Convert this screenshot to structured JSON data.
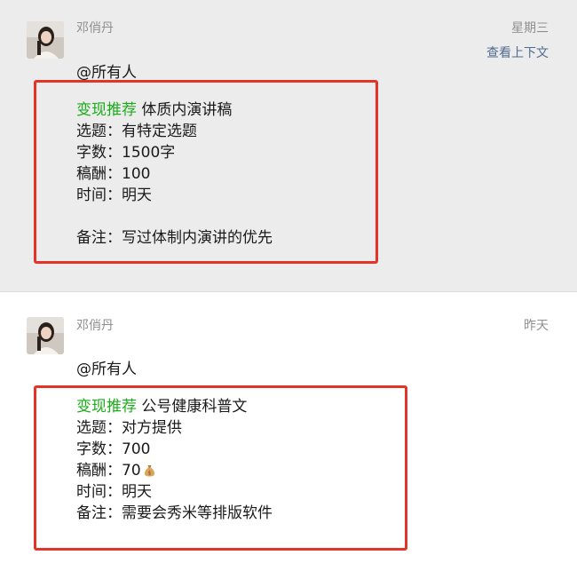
{
  "messages": [
    {
      "sender": "邓俏丹",
      "day": "星期三",
      "context_link": "查看上下文",
      "mention": "@所有人",
      "tag": "变现推荐",
      "title": "体质内演讲稿",
      "lines": [
        "选题：有特定选题",
        "字数：1500字",
        "稿酬：100",
        "时间：明天"
      ],
      "note": "备注：写过体制内演讲的优先"
    },
    {
      "sender": "邓俏丹",
      "day": "昨天",
      "mention": "@所有人",
      "tag": "变现推荐",
      "title": "公号健康科普文",
      "lines": [
        "选题：对方提供",
        "字数：700",
        "稿酬：70",
        "时间：明天",
        "备注：需要会秀米等排版软件"
      ],
      "pay_icon": "money-bag-icon"
    }
  ],
  "colors": {
    "tag_green": "#1aad19",
    "highlight_red": "#e3342a",
    "link_blue": "#4e6a91",
    "meta_gray": "#8f8f8f",
    "top_bg": "#ececec"
  }
}
